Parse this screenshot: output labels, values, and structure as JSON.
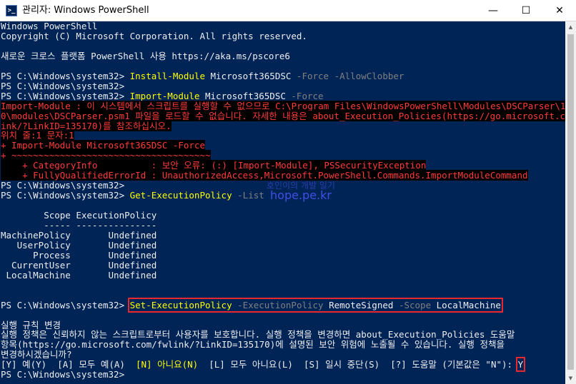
{
  "window": {
    "title": "관리자: Windows PowerShell",
    "icon": "powershell-icon",
    "buttons": {
      "minimize": "—",
      "maximize": "☐",
      "close": "✕"
    }
  },
  "colors": {
    "console_bg": "#012456",
    "text": "#eeedf0",
    "command": "#ffff00",
    "parameter": "#808080",
    "error": "#ff3b3b",
    "highlight_box": "#e8282f"
  },
  "lines": [
    [
      [
        "w",
        "Windows PowerShell"
      ]
    ],
    [
      [
        "w",
        "Copyright (C) Microsoft Corporation. All rights reserved."
      ]
    ],
    [],
    [
      [
        "w",
        "새로운 크로스 플랫폼 PowerShell 사용 https://aka.ms/pscore6"
      ]
    ],
    [],
    [
      [
        "w",
        "PS C:\\Windows\\system32> "
      ],
      [
        "y",
        "Install-Module"
      ],
      [
        "w",
        " Microsoft365DSC "
      ],
      [
        "g",
        "-Force -AllowClobber"
      ]
    ],
    [
      [
        "w",
        "PS C:\\Windows\\system32>"
      ]
    ],
    [
      [
        "w",
        "PS C:\\Windows\\system32> "
      ],
      [
        "y",
        "Import-Module"
      ],
      [
        "w",
        " Microsoft365DSC "
      ],
      [
        "g",
        "-Force"
      ]
    ],
    [
      [
        "r",
        "Import-Module : 이 시스템에서 스크립트를 실행할 수 없으므로 C:\\Program Files\\WindowsPowerShell\\Modules\\DSCParser\\1."
      ]
    ],
    [
      [
        "r",
        "0\\modules\\DSCParser.psm1 파일을 로드할 수 없습니다. 자세한 내용은 about_Execution_Policies(https://go.microsoft.com"
      ]
    ],
    [
      [
        "r",
        "ink/?LinkID=135170)를 참조하십시오."
      ]
    ],
    [
      [
        "r",
        "위치 줄:1 문자:1"
      ]
    ],
    [
      [
        "r",
        "+ Import-Module Microsoft365DSC -Force"
      ]
    ],
    [
      [
        "r",
        "+ ~~~~~~~~~~~~~~~~~~~~~~~~~~~~~~~~~~~~~"
      ]
    ],
    [
      [
        "r",
        "    + CategoryInfo          : 보안 오류: (:) [Import-Module], PSSecurityException"
      ]
    ],
    [
      [
        "r",
        "    + FullyQualifiedErrorId : UnauthorizedAccess,Microsoft.PowerShell.Commands.ImportModuleCommand"
      ]
    ],
    [
      [
        "w",
        "PS C:\\Windows\\system32>"
      ]
    ],
    [
      [
        "w",
        "PS C:\\Windows\\system32> "
      ],
      [
        "y",
        "Get-ExecutionPolicy"
      ],
      [
        "w",
        " "
      ],
      [
        "g",
        "-List"
      ]
    ],
    [],
    [
      [
        "w",
        "        Scope ExecutionPolicy"
      ]
    ],
    [
      [
        "w",
        "        ----- ---------------"
      ]
    ],
    [
      [
        "w",
        "MachinePolicy       Undefined"
      ]
    ],
    [
      [
        "w",
        "   UserPolicy       Undefined"
      ]
    ],
    [
      [
        "w",
        "      Process       Undefined"
      ]
    ],
    [
      [
        "w",
        "  CurrentUser       Undefined"
      ]
    ],
    [
      [
        "w",
        " LocalMachine       Undefined"
      ]
    ],
    [],
    [],
    [
      [
        "w",
        "PS C:\\Windows\\system32> "
      ],
      [
        "y",
        "Set-ExecutionPolicy"
      ],
      [
        "w",
        " "
      ],
      [
        "g",
        "-ExecutionPolicy"
      ],
      [
        "w",
        " RemoteSigned "
      ],
      [
        "g",
        "-Scope"
      ],
      [
        "w",
        " LocalMachine"
      ]
    ],
    [],
    [
      [
        "w",
        "실행 규칙 변경"
      ]
    ],
    [
      [
        "w",
        "실행 정책은 신뢰하지 않는 스크립트로부터 사용자를 보호합니다. 실행 정책을 변경하면 about_Execution_Policies 도움말"
      ]
    ],
    [
      [
        "w",
        "항목(https://go.microsoft.com/fwlink/?LinkID=135170)에 설명된 보안 위험에 노출될 수 있습니다. 실행 정책을"
      ]
    ],
    [
      [
        "w",
        "변경하시겠습니까?"
      ]
    ],
    [
      [
        "w",
        "[Y] 예(Y)  [A] 모두 예(A)  "
      ],
      [
        "y",
        "[N] 아니요(N)"
      ],
      [
        "w",
        "  [L] 모두 아니요(L)  [S] 일시 중단(S)  [?] 도움말 (기본값은 \"N\"): "
      ],
      [
        "w",
        "Y"
      ]
    ],
    [
      [
        "w",
        "PS C:\\Windows\\system32> "
      ]
    ]
  ],
  "watermark": {
    "line1": "호인이의 개발 일기",
    "line2": "hope.pe.kr"
  }
}
